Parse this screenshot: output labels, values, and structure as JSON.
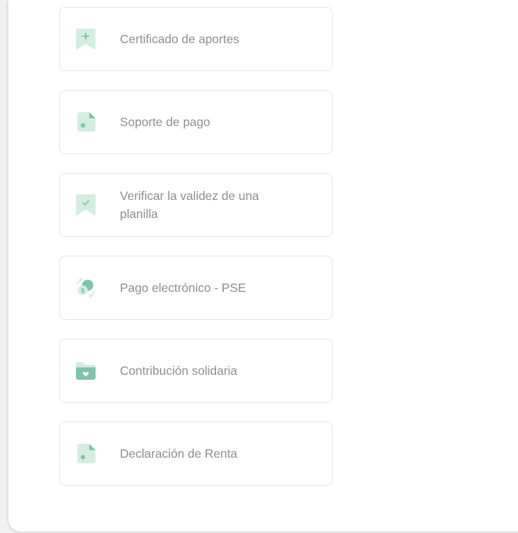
{
  "menu": {
    "items": [
      {
        "label": "Certificado de aportes",
        "icon": "bookmark-plus-icon"
      },
      {
        "label": "Soporte de pago",
        "icon": "document-icon"
      },
      {
        "label": "Verificar la validez de una planilla",
        "icon": "bookmark-check-icon"
      },
      {
        "label": "Pago electrónico - PSE",
        "icon": "money-exchange-icon"
      },
      {
        "label": "Contribución solidaria",
        "icon": "folder-heart-icon"
      },
      {
        "label": "Declaración de Renta",
        "icon": "document-icon"
      }
    ]
  },
  "colors": {
    "accent": "#7fc3a8",
    "accent_light": "#d5ece3",
    "text": "#8e8e8e",
    "border": "#e4e4e4"
  }
}
